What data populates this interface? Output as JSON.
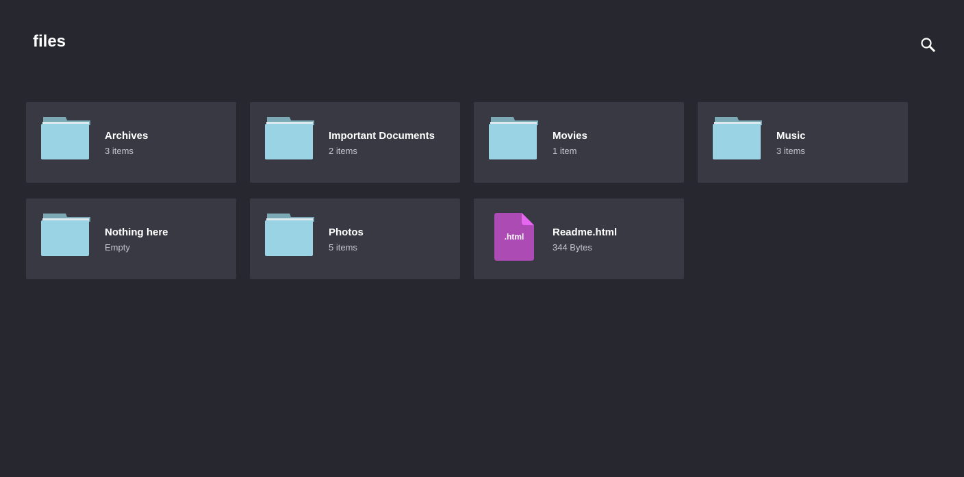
{
  "header": {
    "title": "files",
    "search_icon": "search-icon"
  },
  "colors": {
    "background": "#272730",
    "card": "#393943",
    "folder_body": "#99d3e4",
    "folder_tab": "#7ba9b5",
    "html_file": "#ad4bb5",
    "html_file_fold": "#e566ef"
  },
  "items": [
    {
      "name": "Archives",
      "meta": "3 items",
      "type": "folder",
      "icon": "folder-icon"
    },
    {
      "name": "Important Documents",
      "meta": "2 items",
      "type": "folder",
      "icon": "folder-icon"
    },
    {
      "name": "Movies",
      "meta": "1 item",
      "type": "folder",
      "icon": "folder-icon"
    },
    {
      "name": "Music",
      "meta": "3 items",
      "type": "folder",
      "icon": "folder-icon"
    },
    {
      "name": "Nothing here",
      "meta": "Empty",
      "type": "folder",
      "icon": "folder-icon"
    },
    {
      "name": "Photos",
      "meta": "5 items",
      "type": "folder",
      "icon": "folder-icon"
    },
    {
      "name": "Readme.html",
      "meta": "344 Bytes",
      "type": "file",
      "icon": "html-file-icon",
      "ext": ".html"
    }
  ]
}
